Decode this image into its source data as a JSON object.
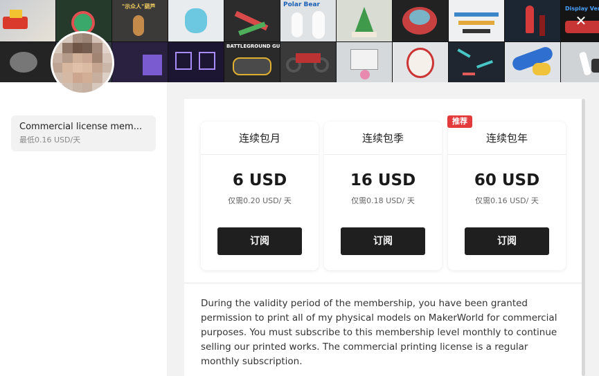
{
  "banner": {
    "tile_labels": [
      "\"示众人\"葫芦",
      "Polar Bear",
      "BATTLEGROUND GUARD",
      "Display Vertical"
    ],
    "close_icon": "close-icon"
  },
  "sidebar": {
    "plan": {
      "title": "Commercial license mem...",
      "subtitle": "最低0.16 USD/天"
    }
  },
  "tiers": [
    {
      "name": "连续包月",
      "price": "6 USD",
      "daily": "仅需0.20 USD/ 天",
      "button": "订阅"
    },
    {
      "name": "连续包季",
      "price": "16 USD",
      "daily": "仅需0.18 USD/ 天",
      "button": "订阅"
    },
    {
      "name": "连续包年",
      "price": "60 USD",
      "daily": "仅需0.16 USD/ 天",
      "button": "订阅"
    }
  ],
  "badge": "推荐",
  "description": "During the validity period of the membership, you have been granted permission to print all of my physical models on MakerWorld for commercial purposes. You must subscribe to this membership level monthly to continue selling our printed works. The commercial printing license is a regular monthly subscription.",
  "colors": {
    "button": "#1f1f1f",
    "badge": "#e33b3b"
  }
}
